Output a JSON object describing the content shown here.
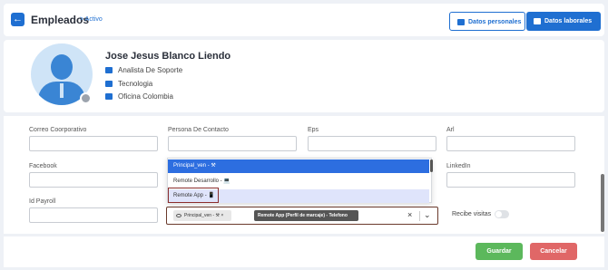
{
  "header": {
    "back_icon": "arrow-left-icon",
    "title": "Empleados",
    "breadcrumb": "> Activo",
    "tabs": [
      {
        "label": "Datos personales",
        "icon": "id-card-icon",
        "active": false
      },
      {
        "label": "Datos laborales",
        "icon": "briefcase-icon",
        "active": true
      }
    ]
  },
  "profile": {
    "name": "Jose Jesus Blanco Liendo",
    "position": "Analista De Soporte",
    "area": "Tecnologia",
    "office": "Oficina Colombia",
    "status_color": "#9ca3ad"
  },
  "form": {
    "row1": {
      "correo_label": "Correo Coorporativo",
      "contacto_label": "Persona De Contacto",
      "eps_label": "Eps",
      "arl_label": "Arl"
    },
    "row2": {
      "facebook_label": "Facebook",
      "linkedin_label": "LinkedIn"
    },
    "row3": {
      "payroll_label": "Id Payroll",
      "visitas_label": "Recibe visitas"
    },
    "dropdown": {
      "options": [
        "Principal_ven - ⚒",
        "Remote Desarrollo - 💻",
        "Remote App - 📱"
      ]
    },
    "multiselect": {
      "chips": [
        "Principal_ven - ⚒ ×",
        "Remote App (Perfil de marcaje) - Telefono"
      ],
      "clear_icon": "×",
      "arrow_icon": "⌄"
    }
  },
  "footer": {
    "save_label": "Guardar",
    "cancel_label": "Cancelar"
  },
  "colors": {
    "primary": "#1f6fd1",
    "save": "#5cb85c",
    "cancel": "#e06767"
  }
}
